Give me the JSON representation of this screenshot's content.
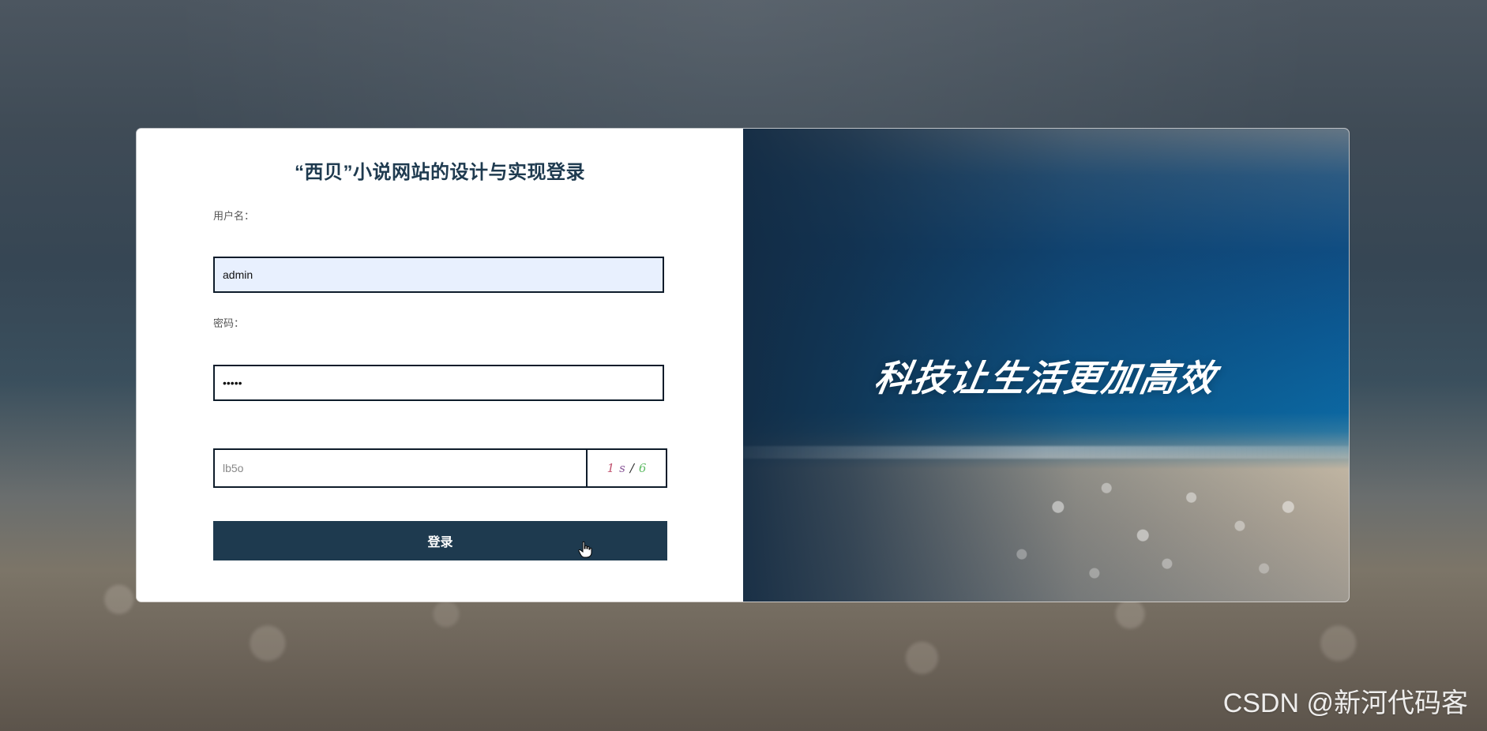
{
  "form": {
    "title": "“西贝”小说网站的设计与实现登录",
    "username_label": "用户名：",
    "username_value": "admin",
    "password_label": "密码：",
    "password_value": "admin",
    "captcha_placeholder": "lb5o",
    "captcha_chars": [
      "1",
      "s",
      "/",
      "6"
    ],
    "login_button": "登录"
  },
  "hero": {
    "slogan": "科技让生活更加高效"
  },
  "watermark": "CSDN @新河代码客",
  "colors": {
    "primary": "#1e3a4f",
    "input_border": "#0e1c2a",
    "input_filled_bg": "#e8f0fe",
    "captcha_char_1": "#c0506d",
    "captcha_char_2": "#8b5a9a",
    "captcha_char_3": "#222222",
    "captcha_char_4": "#5dbb63"
  },
  "icons": {
    "cursor": "hand-pointer-icon"
  }
}
